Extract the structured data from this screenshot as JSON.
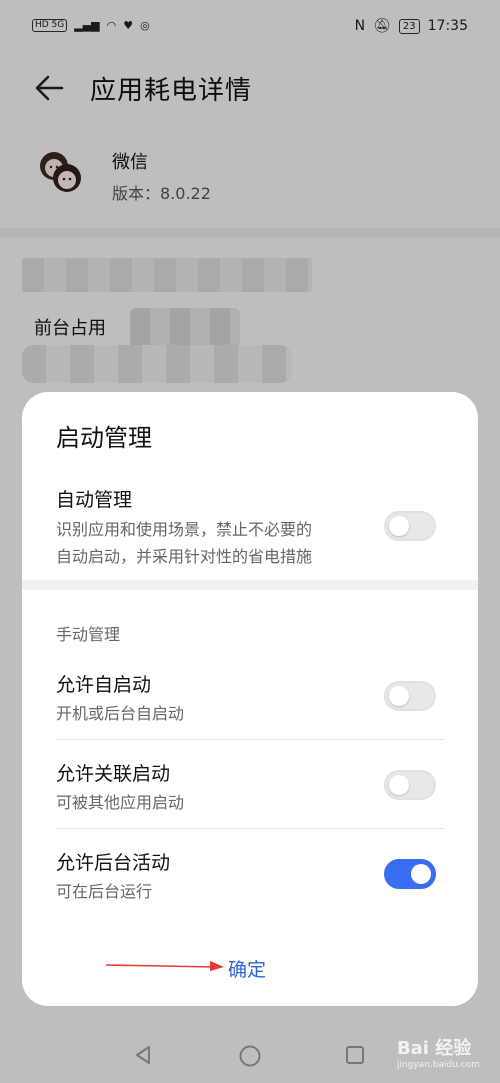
{
  "status_bar": {
    "left": "HD 5G",
    "battery": "23",
    "time": "17:35"
  },
  "header": {
    "title": "应用耗电详情"
  },
  "app": {
    "name": "微信",
    "version": "版本：8.0.22"
  },
  "background": {
    "foreground_label": "前台占用"
  },
  "dialog": {
    "title": "启动管理",
    "auto": {
      "title": "自动管理",
      "desc_line1": "识别应用和使用场景，禁止不必要的",
      "desc_line2": "自动启动，并采用针对性的省电措施",
      "enabled": false
    },
    "group_label": "手动管理",
    "items": [
      {
        "title": "允许自启动",
        "desc": "开机或后台自启动",
        "enabled": false
      },
      {
        "title": "允许关联启动",
        "desc": "可被其他应用启动",
        "enabled": false
      },
      {
        "title": "允许后台活动",
        "desc": "可在后台运行",
        "enabled": true
      }
    ],
    "confirm_label": "确定"
  },
  "watermark": {
    "text": "Bai 经验",
    "sub": "jingyan.baidu.com"
  },
  "colors": {
    "accent": "#3a6ef2",
    "confirm": "#2f62d9",
    "arrow": "#e53935"
  }
}
